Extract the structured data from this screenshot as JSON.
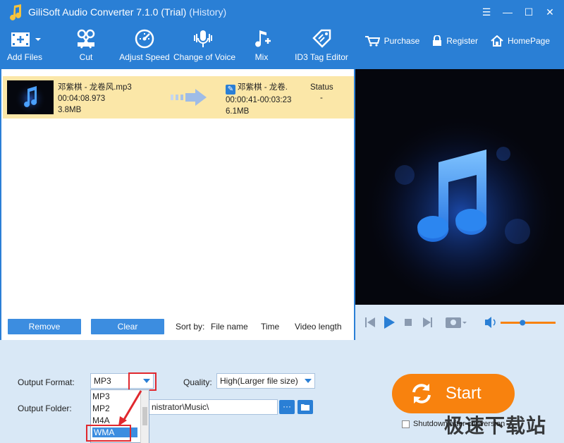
{
  "window": {
    "title": "GiliSoft Audio Converter 7.1.0 (Trial)",
    "history": "(History)"
  },
  "toolbar": {
    "add_files": "Add Files",
    "cut": "Cut",
    "adjust_speed": "Adjust Speed",
    "change_voice": "Change of Voice",
    "mix": "Mix",
    "id3": "ID3 Tag Editor",
    "purchase": "Purchase",
    "register": "Register",
    "homepage": "HomePage"
  },
  "file": {
    "src_name": "邓紫棋 - 龙卷风.mp3",
    "src_duration": "00:04:08.973",
    "src_size": "3.8MB",
    "dst_name": "邓紫棋 - 龙卷.",
    "dst_range": "00:00:41-00:03:23",
    "dst_size": "6.1MB",
    "status_header": "Status",
    "status_value": "-"
  },
  "list_controls": {
    "remove": "Remove",
    "clear": "Clear",
    "sort_by": "Sort by:",
    "file_name": "File name",
    "time": "Time",
    "video_length": "Video length"
  },
  "output": {
    "format_label": "Output Format:",
    "format_value": "MP3",
    "quality_label": "Quality:",
    "quality_value": "High(Larger file size)",
    "folder_label": "Output Folder:",
    "folder_value": "nistrator\\Music\\",
    "more": "···",
    "options": [
      "MP3",
      "MP2",
      "M4A",
      "WMA"
    ]
  },
  "actions": {
    "start": "Start",
    "shutdown": "Shutdown after conversion"
  },
  "player": {
    "volume": 0.4
  },
  "watermark": "极速下载站",
  "colors": {
    "accent": "#2a7fd5",
    "start": "#f8820e",
    "highlight": "#fbe7a8",
    "marker": "#e0282e"
  }
}
